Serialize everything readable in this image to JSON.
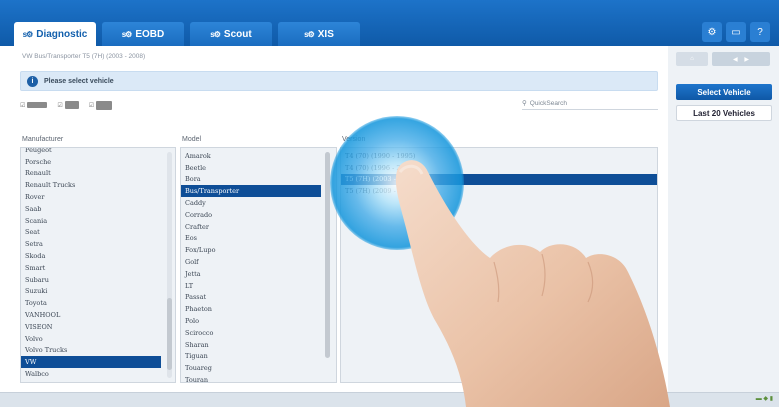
{
  "tabs": [
    {
      "label": "Diagnostic",
      "logo": "s⚙"
    },
    {
      "label": "EOBD",
      "logo": "s⚙"
    },
    {
      "label": "Scout",
      "logo": "s⚙"
    },
    {
      "label": "XIS",
      "logo": "s⚙"
    }
  ],
  "toolbar": {
    "settings_icon": "gear-icon",
    "message_icon": "chat-icon",
    "help_label": "?"
  },
  "breadcrumb": "VW Bus/Transporter T5 (7H) (2003 - 2008)",
  "notice": {
    "icon": "info-icon",
    "text": "Please select vehicle"
  },
  "search": {
    "placeholder": "QuickSearch"
  },
  "columns": {
    "manufacturer": "Manufacturer",
    "model": "Model",
    "version": "Version"
  },
  "manufacturers": [
    "Peugeot",
    "Porsche",
    "Renault",
    "Renault Trucks",
    "Rover",
    "Saab",
    "Scania",
    "Seat",
    "Setra",
    "Skoda",
    "Smart",
    "Subaru",
    "Suzuki",
    "Toyota",
    "VANHOOL",
    "VISEON",
    "Volvo",
    "Volvo Trucks",
    "VW",
    "Walbco"
  ],
  "selected_manufacturer": "VW",
  "models": [
    "Amarok",
    "Beetle",
    "Bora",
    "Bus/Transporter",
    "Caddy",
    "Corrado",
    "Crafter",
    "Eos",
    "Fox/Lupo",
    "Golf",
    "Jetta",
    "LT",
    "Passat",
    "Phaeton",
    "Polo",
    "Scirocco",
    "Sharan",
    "Tiguan",
    "Touareg",
    "Touran"
  ],
  "selected_model": "Bus/Transporter",
  "versions": [
    "T4 (70) (1990 - 1995)",
    "T4 (70) (1996 - 2003)",
    "T5 (7H) (2003 - 2008)",
    "T5 (7H) (2009 - )"
  ],
  "selected_version": "T5 (7H) (2003 - 2008)",
  "side": {
    "home_icon": "home-icon",
    "prev_icon": "chevron-left-icon",
    "next_icon": "chevron-right-icon",
    "select_vehicle": "Select Vehicle",
    "last20": "Last 20 Vehicles"
  },
  "colors": {
    "brand": "#1360ad",
    "selection": "#0e4e97",
    "panel": "#eef2f6"
  }
}
